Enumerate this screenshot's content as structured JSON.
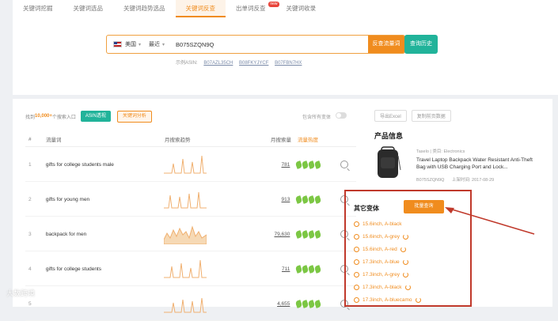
{
  "tabs": [
    {
      "label": "关键词挖掘",
      "active": false,
      "badge": ""
    },
    {
      "label": "关键词选品",
      "active": false,
      "badge": ""
    },
    {
      "label": "关键词趋势选品",
      "active": false,
      "badge": ""
    },
    {
      "label": "关键词反查",
      "active": true,
      "badge": ""
    },
    {
      "label": "出单词反查",
      "active": false,
      "badge": "new"
    },
    {
      "label": "关键词收录",
      "active": false,
      "badge": ""
    }
  ],
  "search": {
    "country": "美国",
    "period": "最近",
    "value": "B075SZQN9Q",
    "submit_label": "反查流量词",
    "history_label": "查询历史",
    "examples_label": "示例ASIN:",
    "examples": [
      "B07AZL35CH",
      "B08FKYJYCF",
      "B07FBN7HX"
    ]
  },
  "toolbar": {
    "prefix": "找到",
    "count": "10,000+",
    "suffix": "个搜索入口",
    "asin_chip": "ASIN透视",
    "keyword_chip": "关键词分析",
    "toggle_label": "包含所有变体"
  },
  "table": {
    "headers": {
      "num": "#",
      "keyword": "流量词",
      "trend": "月搜索趋势",
      "volume": "月搜索量",
      "popularity": "流量热度"
    },
    "rows": [
      {
        "num": "1",
        "keyword": "gifts for college students male",
        "volume": "781"
      },
      {
        "num": "2",
        "keyword": "gifts for young men",
        "volume": "913"
      },
      {
        "num": "3",
        "keyword": "backpack for men",
        "volume": "79,630"
      },
      {
        "num": "4",
        "keyword": "gifts for college students",
        "volume": "711"
      },
      {
        "num": "5",
        "keyword": "",
        "volume": "4,655"
      }
    ]
  },
  "side": {
    "export_label": "导出Excel",
    "copy_label": "复制前页数据",
    "product_title": "产品信息",
    "meta": "Taselo | 类目: Electronics",
    "name": "Travel Laptop Backpack Water Resistant Anti-Theft Bag with USB Charging Port and Lock...",
    "asin": "B075SZQN9Q",
    "date_label": "上架时间: 2017-08-29"
  },
  "variants": {
    "title": "其它变体",
    "button": "批量查询",
    "items": [
      {
        "label": "15.6inch, A-black",
        "state": "active"
      },
      {
        "label": "15.6inch, A-grey",
        "state": "loading"
      },
      {
        "label": "15.6inch, A-red",
        "state": "loading"
      },
      {
        "label": "17.3inch, A-blue",
        "state": "loading"
      },
      {
        "label": "17.3inch, A-grey",
        "state": "loading"
      },
      {
        "label": "17.3inch, A-black",
        "state": "loading"
      },
      {
        "label": "17.3inch, A-bluecamo",
        "state": "loading"
      }
    ]
  },
  "watermark": "大数跨境",
  "colors": {
    "accent": "#f08c1e",
    "teal": "#21b39a",
    "highlight_border": "#c0392b",
    "leaf": "#7cc744"
  }
}
